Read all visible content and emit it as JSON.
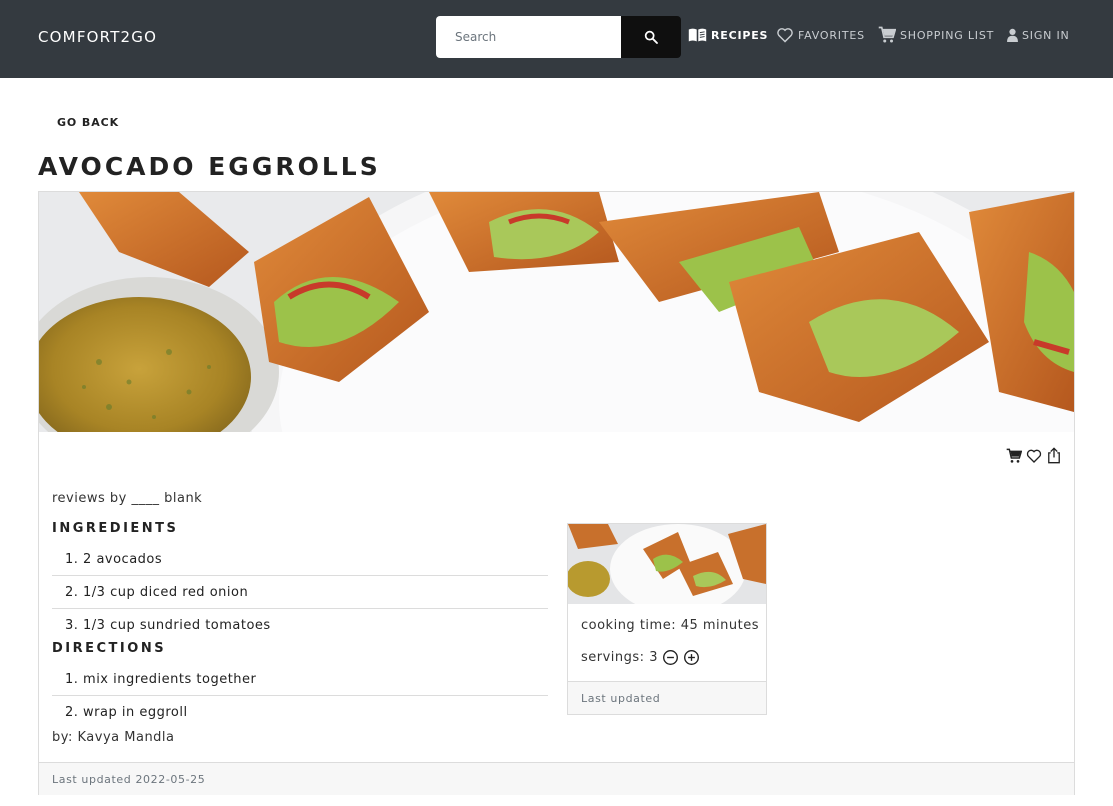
{
  "header": {
    "brand": "COMFORT2GO",
    "search": {
      "placeholder": "Search"
    },
    "nav": [
      {
        "label": "RECIPES",
        "icon": "menu-book-icon",
        "active": true
      },
      {
        "label": "FAVORITES",
        "icon": "heart-icon",
        "active": false
      },
      {
        "label": "SHOPPING LIST",
        "icon": "cart-icon",
        "active": false
      },
      {
        "label": "SIGN IN",
        "icon": "person-icon",
        "active": false
      }
    ]
  },
  "page": {
    "back_label": "GO BACK",
    "title": "AVOCADO EGGROLLS"
  },
  "recipe": {
    "reviews": "reviews by ____ blank",
    "ingredients_title": "INGREDIENTS",
    "ingredients": [
      "1. 2 avocados",
      "2. 1/3 cup diced red onion",
      "3. 1/3 cup sundried tomatoes"
    ],
    "directions_title": "DIRECTIONS",
    "directions": [
      "1. mix ingredients together",
      "2. wrap in eggroll"
    ],
    "author": "by: Kavya Mandla",
    "last_updated": "Last updated 2022-05-25",
    "actions": [
      "cart-icon",
      "heart-icon",
      "share-icon"
    ]
  },
  "info_card": {
    "cooking_time": "cooking time: 45 minutes",
    "servings_label": "servings: 3",
    "servings": 3,
    "last_updated": "Last updated"
  },
  "colors": {
    "header_bg": "#343a40",
    "search_button": "#0f0f0f",
    "border": "#dcdcdc",
    "footer_bg": "#f7f7f7"
  }
}
